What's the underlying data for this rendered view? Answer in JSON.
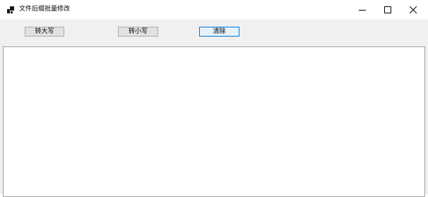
{
  "window": {
    "title": "文件后缀批量修改",
    "icon": "app-window-icon",
    "controls": {
      "minimize": "minimize-icon",
      "maximize": "maximize-icon",
      "close": "close-icon"
    }
  },
  "toolbar": {
    "to_upper_label": "转大写",
    "to_lower_label": "转小写",
    "clear_label": "清除"
  },
  "editor": {
    "value": ""
  },
  "colors": {
    "window_bg": "#f0f0f0",
    "button_bg": "#e1e1e1",
    "default_button_border": "#0078d7"
  }
}
